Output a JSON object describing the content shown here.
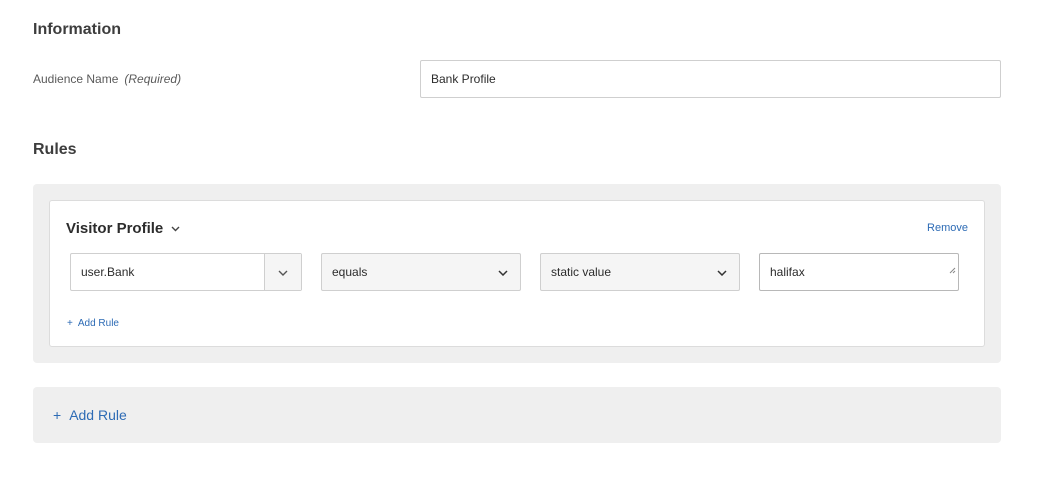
{
  "information": {
    "heading": "Information",
    "audience_label": "Audience Name",
    "required_label": "(Required)",
    "audience_value": "Bank Profile"
  },
  "rules": {
    "heading": "Rules",
    "card": {
      "title": "Visitor Profile",
      "remove_label": "Remove",
      "field_value": "user.Bank",
      "operator_value": "equals",
      "value_type": "static value",
      "comparison_value": "halifax",
      "add_rule_label": "Add Rule",
      "add_rule_icon": "+"
    },
    "add_rule": {
      "icon": "+",
      "label": "Add Rule"
    }
  },
  "colors": {
    "link": "#2d6bb5",
    "panel": "#efefef",
    "border": "#cfcfcf"
  },
  "icons": {
    "title_chevron": "chevron-down-icon",
    "select_chevron": "chevron-down-icon",
    "resize": "resize-grip-icon"
  }
}
